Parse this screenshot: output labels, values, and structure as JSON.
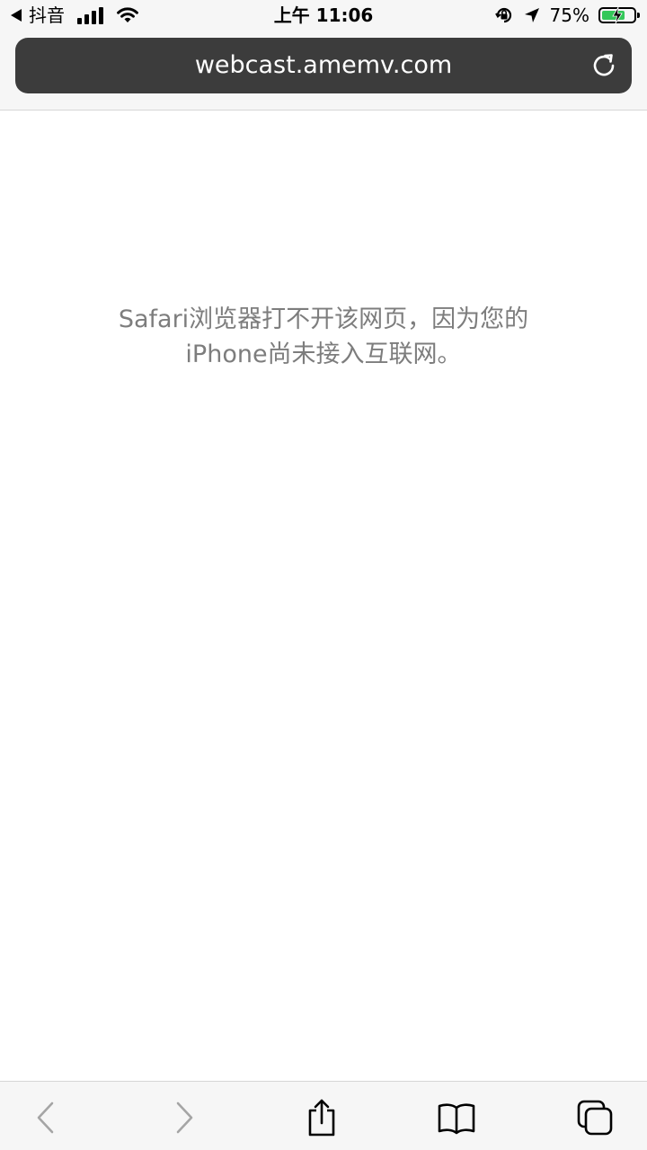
{
  "status_bar": {
    "back_app": "抖音",
    "time": "上午 11:06",
    "battery_percent": "75%",
    "battery_level": 0.75,
    "battery_color": "#34c759",
    "icons": [
      "back-triangle-icon",
      "cellular-signal-icon",
      "wifi-icon",
      "orientation-lock-icon",
      "location-arrow-icon",
      "battery-charging-icon"
    ]
  },
  "url_bar": {
    "url": "webcast.amemv.com",
    "reload_icon": "reload-icon"
  },
  "content": {
    "error_line1": "Safari浏览器打不开该网页，因为您的",
    "error_line2": "iPhone尚未接入互联网。"
  },
  "toolbar": {
    "buttons": [
      "back-icon",
      "forward-icon",
      "share-icon",
      "bookmarks-icon",
      "tabs-icon"
    ]
  },
  "colors": {
    "url_bar_bg": "#3c3c3c",
    "message_text": "#7d7d7d",
    "toolbar_icon": "#000000",
    "toolbar_icon_disabled": "#a5a5a5"
  }
}
